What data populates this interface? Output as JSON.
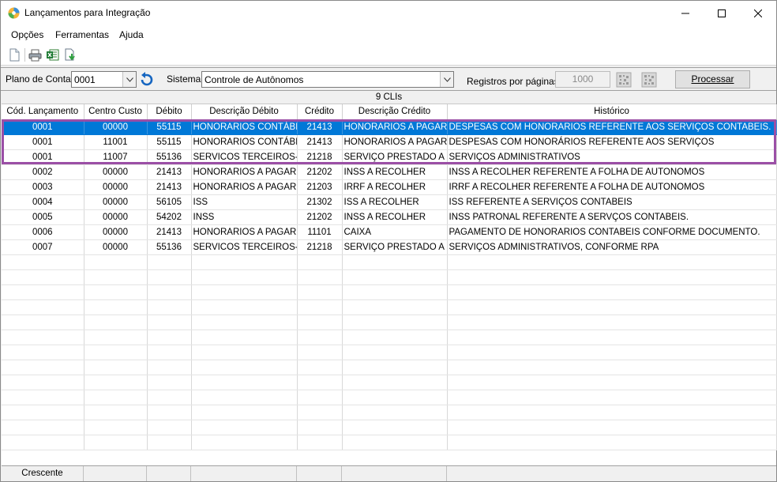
{
  "window": {
    "title": "Lançamentos para Integração"
  },
  "menu": {
    "items": [
      {
        "label": "Opções"
      },
      {
        "label": "Ferramentas"
      },
      {
        "label": "Ajuda"
      }
    ]
  },
  "toolbar": {
    "icons": [
      "new-document-icon",
      "print-icon",
      "excel-export-icon",
      "import-icon"
    ]
  },
  "filters": {
    "plano_label": "Plano de Contas",
    "plano_value": "0001",
    "sistema_label": "Sistema",
    "sistema_value": "Controle de Autônomos",
    "registros_label": "Registros por páginas:",
    "registros_value": "1000",
    "processar_label": "Processar"
  },
  "grid": {
    "caption": "9 CLIs",
    "columns": [
      "Cód. Lançamento",
      "Centro Custo",
      "Débito",
      "Descrição Débito",
      "Crédito",
      "Descrição Crédito",
      "Histórico"
    ],
    "rows": [
      {
        "cod": "0001",
        "cc": "00000",
        "deb": "55115",
        "desc_deb": "HONORARIOS CONTÁBEIS",
        "cred": "21413",
        "desc_cred": "HONORARIOS A PAGAR",
        "hist": "DESPESAS COM HONORARIOS REFERENTE AOS SERVIÇOS CONTABEIS.",
        "selected": true
      },
      {
        "cod": "0001",
        "cc": "11001",
        "deb": "55115",
        "desc_deb": "HONORARIOS CONTÁBEIS",
        "cred": "21413",
        "desc_cred": "HONORARIOS A PAGAR",
        "hist": "DESPESAS COM HONORÁRIOS REFERENTE AOS SERVIÇOS",
        "selected": false
      },
      {
        "cod": "0001",
        "cc": "11007",
        "deb": "55136",
        "desc_deb": "SERVICOS TERCEIROS-PF",
        "cred": "21218",
        "desc_cred": "SERVIÇO PRESTADO A PAGAR",
        "hist": "SERVIÇOS ADMINISTRATIVOS",
        "selected": false
      },
      {
        "cod": "0002",
        "cc": "00000",
        "deb": "21413",
        "desc_deb": "HONORARIOS A PAGAR",
        "cred": "21202",
        "desc_cred": "INSS A RECOLHER",
        "hist": "INSS A RECOLHER REFERENTE A FOLHA DE AUTONOMOS",
        "selected": false
      },
      {
        "cod": "0003",
        "cc": "00000",
        "deb": "21413",
        "desc_deb": "HONORARIOS A PAGAR",
        "cred": "21203",
        "desc_cred": "IRRF A RECOLHER",
        "hist": "IRRF A RECOLHER REFERENTE A FOLHA DE AUTONOMOS",
        "selected": false
      },
      {
        "cod": "0004",
        "cc": "00000",
        "deb": "56105",
        "desc_deb": "ISS",
        "cred": "21302",
        "desc_cred": "ISS A RECOLHER",
        "hist": "ISS REFERENTE A SERVIÇOS CONTABEIS",
        "selected": false
      },
      {
        "cod": "0005",
        "cc": "00000",
        "deb": "54202",
        "desc_deb": "INSS",
        "cred": "21202",
        "desc_cred": "INSS A RECOLHER",
        "hist": "INSS PATRONAL REFERENTE A SERVÇOS CONTABEIS.",
        "selected": false
      },
      {
        "cod": "0006",
        "cc": "00000",
        "deb": "21413",
        "desc_deb": "HONORARIOS A PAGAR",
        "cred": "11101",
        "desc_cred": "CAIXA",
        "hist": "PAGAMENTO DE HONORARIOS CONTABEIS CONFORME DOCUMENTO.",
        "selected": false
      },
      {
        "cod": "0007",
        "cc": "00000",
        "deb": "55136",
        "desc_deb": "SERVICOS TERCEIROS-PF",
        "cred": "21218",
        "desc_cred": "SERVIÇO PRESTADO A PAGAR",
        "hist": "SERVIÇOS ADMINISTRATIVOS, CONFORME RPA",
        "selected": false
      }
    ]
  },
  "footer": {
    "sort_label": "Crescente"
  },
  "colors": {
    "selection": "#0078d7",
    "highlight_border": "#9b4fa6"
  }
}
